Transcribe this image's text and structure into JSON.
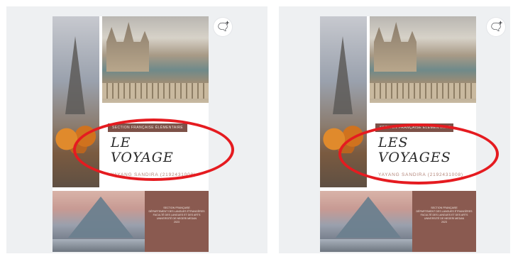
{
  "panels": [
    {
      "banner": "SECTION FRANÇAISE ÉLÉMENTAIRE",
      "title_line1": "LE",
      "title_line2": "VOYAGE",
      "author": "YAYANG SANDIRA (2192431008)",
      "info": [
        "SECTION FRANÇAISE",
        "DÉPARTEMENT DES LANGUES ÉTRANGÈRES",
        "FACULTÉ DES LANGUES ET DES ARTS",
        "UNIVERSITÉ DE NEGERI MEDAN",
        "2023"
      ],
      "comment_icon": "comment-add-icon"
    },
    {
      "banner": "SECTION FRANÇAISE ÉLÉMENTAIRE",
      "title_line1": "LES",
      "title_line2": "VOYAGES",
      "author": "YAYANG SANDIRA (2192431008)",
      "info": [
        "SECTION FRANÇAISE",
        "DÉPARTEMENT DES LANGUES ÉTRANGÈRES",
        "FACULTÉ DES LANGUES ET DES ARTS",
        "UNIVERSITÉ DE NEGERI MEDAN",
        "2023"
      ],
      "comment_icon": "comment-add-icon"
    }
  ],
  "colors": {
    "banner": "#7d5148",
    "info_block": "#8a5a50",
    "annotation": "#e51b20",
    "panel_bg": "#eef0f2"
  }
}
